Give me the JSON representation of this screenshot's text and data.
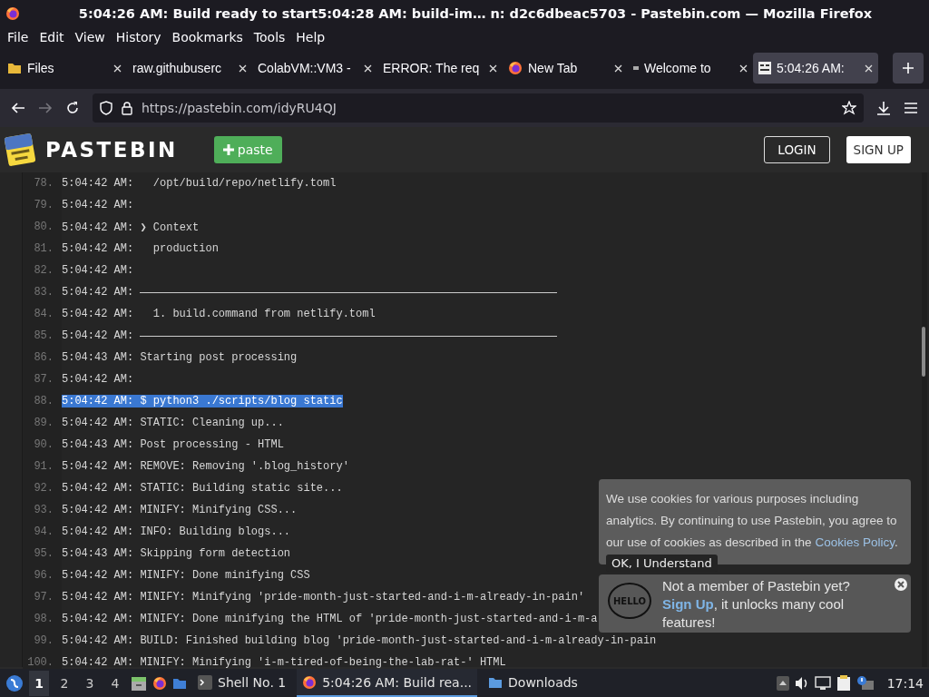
{
  "window": {
    "title": "5:04:26 AM: Build ready to start5:04:28 AM: build-im… n: d2c6dbeac5703 - Pastebin.com — Mozilla Firefox"
  },
  "menu_bar": [
    "File",
    "Edit",
    "View",
    "History",
    "Bookmarks",
    "Tools",
    "Help"
  ],
  "tabs": [
    {
      "label": "Files",
      "kind": "folder",
      "selected": false
    },
    {
      "label": "raw.githubuserc",
      "kind": "plain",
      "selected": false
    },
    {
      "label": "ColabVM::VM3 -",
      "kind": "plain",
      "selected": false
    },
    {
      "label": "ERROR: The req",
      "kind": "plain",
      "selected": false
    },
    {
      "label": "New Tab",
      "kind": "firefox",
      "selected": false
    },
    {
      "label": "Welcome to",
      "kind": "dot",
      "selected": false
    },
    {
      "label": "5:04:26 AM:",
      "kind": "pastebin",
      "selected": true
    }
  ],
  "toolbar": {
    "url": "https://pastebin.com/idyRU4QJ"
  },
  "site": {
    "logo": "PASTEBIN",
    "paste_button": "paste",
    "login": "LOGIN",
    "signup": "SIGN UP"
  },
  "paste": {
    "lines": [
      {
        "number": "78.",
        "kind": "text",
        "selected": false,
        "text": "5:04:42 AM:   /opt/build/repo/netlify.toml"
      },
      {
        "number": "79.",
        "kind": "text",
        "selected": false,
        "text": "5:04:42 AM:"
      },
      {
        "number": "80.",
        "kind": "text",
        "selected": false,
        "text": "5:04:42 AM: ❯ Context"
      },
      {
        "number": "81.",
        "kind": "text",
        "selected": false,
        "text": "5:04:42 AM:   production"
      },
      {
        "number": "82.",
        "kind": "text",
        "selected": false,
        "text": "5:04:42 AM:"
      },
      {
        "number": "83.",
        "kind": "rule",
        "selected": false,
        "text": "5:04:42 AM:"
      },
      {
        "number": "84.",
        "kind": "text",
        "selected": false,
        "text": "5:04:42 AM:   1. build.command from netlify.toml"
      },
      {
        "number": "85.",
        "kind": "rule",
        "selected": false,
        "text": "5:04:42 AM:"
      },
      {
        "number": "86.",
        "kind": "text",
        "selected": false,
        "text": "5:04:43 AM: Starting post processing"
      },
      {
        "number": "87.",
        "kind": "text",
        "selected": false,
        "text": "5:04:42 AM:"
      },
      {
        "number": "88.",
        "kind": "text",
        "selected": true,
        "text": "5:04:42 AM: $ python3 ./scripts/blog static"
      },
      {
        "number": "89.",
        "kind": "text",
        "selected": false,
        "text": "5:04:42 AM: STATIC: Cleaning up..."
      },
      {
        "number": "90.",
        "kind": "text",
        "selected": false,
        "text": "5:04:43 AM: Post processing - HTML"
      },
      {
        "number": "91.",
        "kind": "text",
        "selected": false,
        "text": "5:04:42 AM: REMOVE: Removing '.blog_history'"
      },
      {
        "number": "92.",
        "kind": "text",
        "selected": false,
        "text": "5:04:42 AM: STATIC: Building static site..."
      },
      {
        "number": "93.",
        "kind": "text",
        "selected": false,
        "text": "5:04:42 AM: MINIFY: Minifying CSS..."
      },
      {
        "number": "94.",
        "kind": "text",
        "selected": false,
        "text": "5:04:42 AM: INFO: Building blogs..."
      },
      {
        "number": "95.",
        "kind": "text",
        "selected": false,
        "text": "5:04:43 AM: Skipping form detection"
      },
      {
        "number": "96.",
        "kind": "text",
        "selected": false,
        "text": "5:04:42 AM: MINIFY: Done minifying CSS"
      },
      {
        "number": "97.",
        "kind": "text",
        "selected": false,
        "text": "5:04:42 AM: MINIFY: Minifying 'pride-month-just-started-and-i-m-already-in-pain'"
      },
      {
        "number": "98.",
        "kind": "text",
        "selected": false,
        "text": "5:04:42 AM: MINIFY: Done minifying the HTML of 'pride-month-just-started-and-i-m-a"
      },
      {
        "number": "99.",
        "kind": "text",
        "selected": false,
        "text": "5:04:42 AM: BUILD: Finished building blog 'pride-month-just-started-and-i-m-already-in-pain"
      },
      {
        "number": "100.",
        "kind": "text",
        "selected": false,
        "text": "5:04:42 AM: MINIFY: Minifying 'i-m-tired-of-being-the-lab-rat-' HTML"
      }
    ]
  },
  "cookie_notice": {
    "text": "We use cookies for various purposes including analytics. By continuing to use Pastebin, you agree to our use of cookies as described in the ",
    "link": "Cookies Policy",
    "text_end": ".",
    "button": "OK, I Understand"
  },
  "signup_notice": {
    "bubble": "HELLO",
    "text": "Not a member of Pastebin yet? ",
    "link": "Sign Up",
    "text_end": ", it unlocks many cool features!"
  },
  "taskbar": {
    "workspaces": [
      {
        "label": "1",
        "selected": true
      },
      {
        "label": "2",
        "selected": false
      },
      {
        "label": "3",
        "selected": false
      },
      {
        "label": "4",
        "selected": false
      }
    ],
    "tasks": [
      {
        "label": "Shell No. 1",
        "kind": "terminal",
        "selected": false
      },
      {
        "label": "5:04:26 AM: Build rea...",
        "kind": "firefox",
        "selected": true
      },
      {
        "label": "Downloads",
        "kind": "folder",
        "selected": false
      }
    ],
    "clock": "17:14"
  }
}
